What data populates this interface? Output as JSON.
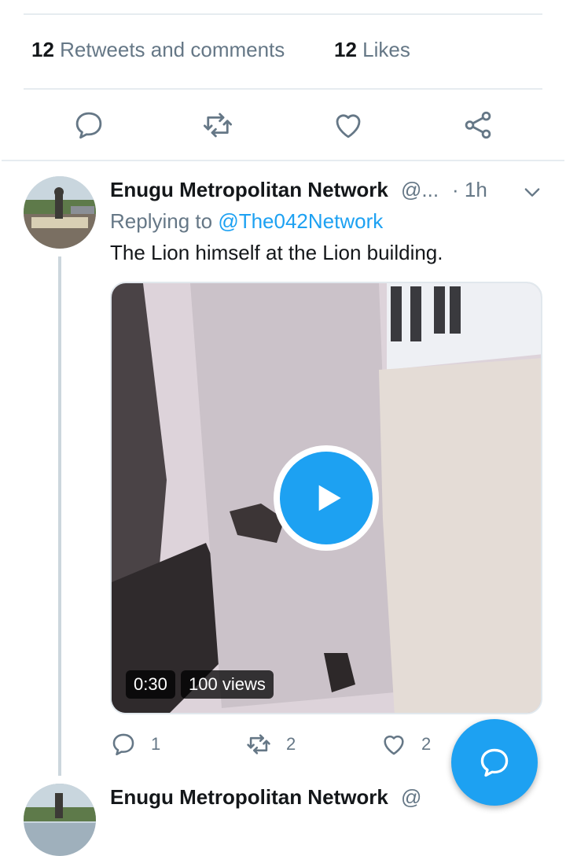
{
  "stats": {
    "retweets_count": "12",
    "retweets_label": "Retweets and comments",
    "likes_count": "12",
    "likes_label": "Likes"
  },
  "actions": {
    "icons": [
      "comment-icon",
      "retweet-icon",
      "like-icon",
      "share-icon"
    ]
  },
  "tweet": {
    "author_name": "Enugu Metropolitan Network",
    "handle": "@...",
    "time": "· 1h",
    "replying_prefix": "Replying to",
    "replying_to": "@The042Network",
    "text": "The Lion himself at the Lion building.",
    "video": {
      "duration": "0:30",
      "views": "100 views"
    },
    "replies": "1",
    "retweets": "2",
    "likes": "2"
  },
  "next_tweet": {
    "author_name": "Enugu Metropolitan Network",
    "handle": "@"
  },
  "colors": {
    "accent": "#1da1f2",
    "secondary_text": "#657786",
    "divider": "#e6ecf0"
  }
}
